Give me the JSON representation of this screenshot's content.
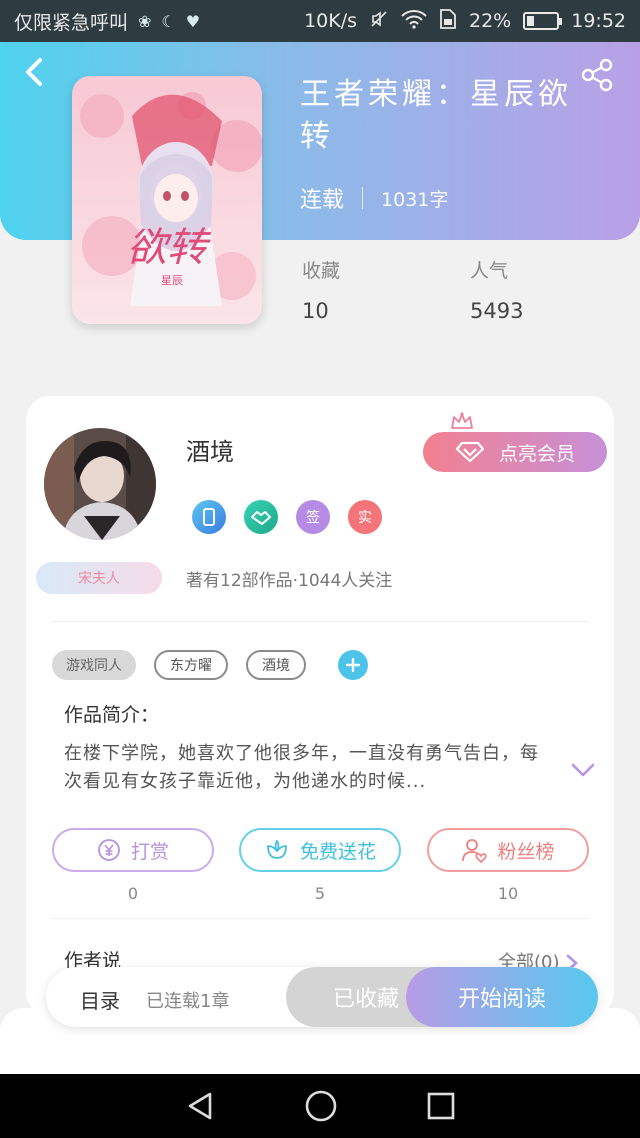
{
  "status_bar": {
    "carrier": "仅限紧急呼叫",
    "speed": "10K/s",
    "battery": "22%",
    "battery_level": 0.22,
    "time": "19:52"
  },
  "book": {
    "title": "王者荣耀：星辰欲转",
    "status": "连载",
    "word_count": "1031字",
    "stats": [
      {
        "label": "收藏",
        "value": "10"
      },
      {
        "label": "人气",
        "value": "5493"
      }
    ]
  },
  "author": {
    "name": "酒境",
    "vip_label": "点亮会员",
    "badges": [
      "sign-badge",
      "heart-badge",
      "签",
      "实"
    ],
    "title_badge": "宋夫人",
    "description": "著有12部作品·1044人关注"
  },
  "tags": [
    "游戏同人",
    "东方曜",
    "酒境"
  ],
  "intro": {
    "label": "作品简介：",
    "text": "在楼下学院，她喜欢了他很多年，一直没有勇气告白，每次看见有女孩子靠近他，为他递水的时候..."
  },
  "actions": [
    {
      "label": "打赏",
      "count": "0",
      "color": "#b792e2"
    },
    {
      "label": "免费送花",
      "count": "5",
      "color": "#4fc9e3"
    },
    {
      "label": "粉丝榜",
      "count": "10",
      "color": "#f08a8a"
    }
  ],
  "author_says": {
    "label": "作者说",
    "all": "全部(0)"
  },
  "bottom_bar": {
    "toc": "目录",
    "toc_sub": "已连载1章",
    "collected": "已收藏",
    "read": "开始阅读"
  }
}
